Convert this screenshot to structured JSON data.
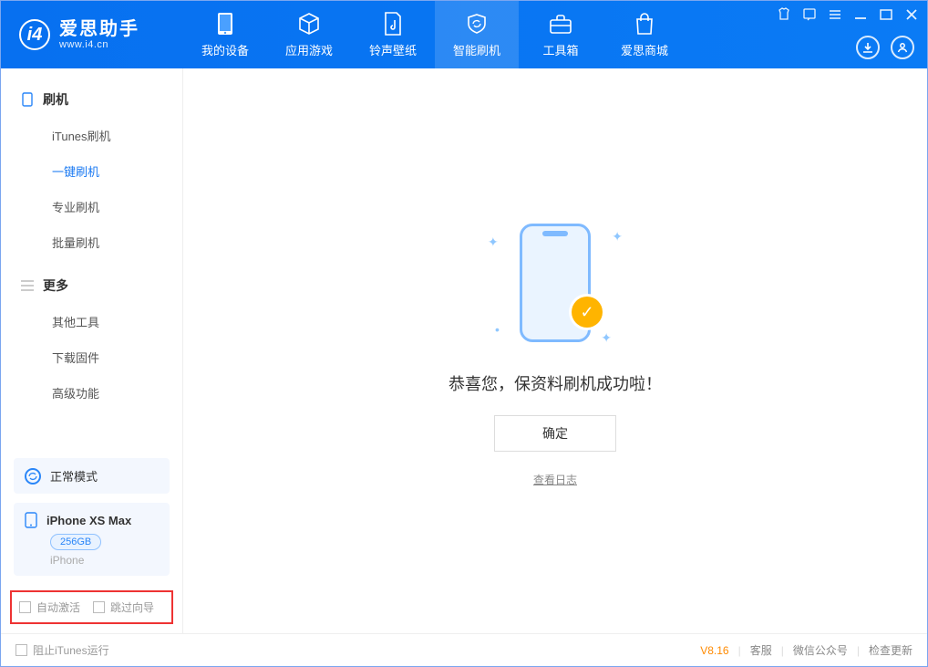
{
  "app": {
    "name": "爱思助手",
    "domain": "www.i4.cn"
  },
  "tabs": [
    {
      "label": "我的设备"
    },
    {
      "label": "应用游戏"
    },
    {
      "label": "铃声壁纸"
    },
    {
      "label": "智能刷机"
    },
    {
      "label": "工具箱"
    },
    {
      "label": "爱思商城"
    }
  ],
  "sidebar": {
    "group1": {
      "title": "刷机",
      "items": [
        "iTunes刷机",
        "一键刷机",
        "专业刷机",
        "批量刷机"
      ]
    },
    "group2": {
      "title": "更多",
      "items": [
        "其他工具",
        "下载固件",
        "高级功能"
      ]
    }
  },
  "status": {
    "mode": "正常模式"
  },
  "device": {
    "name": "iPhone XS Max",
    "storage": "256GB",
    "type": "iPhone"
  },
  "options": {
    "auto_activate": "自动激活",
    "skip_guide": "跳过向导"
  },
  "main": {
    "success_text": "恭喜您，保资料刷机成功啦！",
    "ok_label": "确定",
    "log_label": "查看日志"
  },
  "footer": {
    "block_itunes": "阻止iTunes运行",
    "version": "V8.16",
    "links": [
      "客服",
      "微信公众号",
      "检查更新"
    ]
  }
}
